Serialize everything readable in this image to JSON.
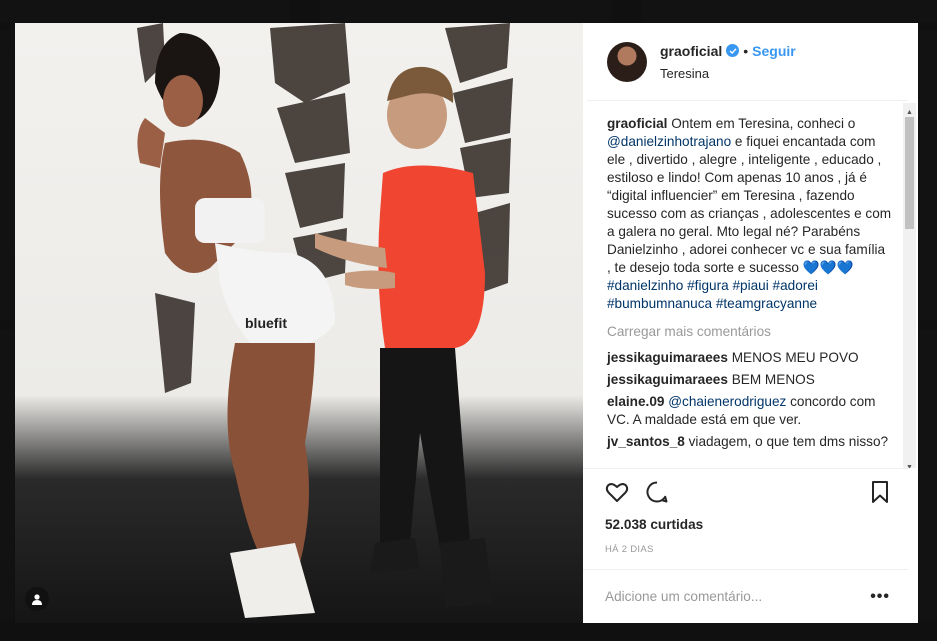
{
  "post": {
    "username": "graoficial",
    "follow_label": "Seguir",
    "location": "Teresina",
    "caption_user": "graoficial",
    "caption_parts": [
      {
        "t": "text",
        "v": " Ontem em Teresina, conheci o "
      },
      {
        "t": "link",
        "v": "@danielzinhotrajano"
      },
      {
        "t": "text",
        "v": " e fiquei encantada com ele , divertido , alegre , inteligente , educado , estiloso e lindo! Com apenas 10 anos , já é “digital influencier” em Teresina , fazendo sucesso com as crianças , adolescentes e com a galera no geral. Mto legal né? Parabéns Danielzinho , adorei conhecer vc e sua família , te desejo toda sorte e sucesso 💙💙💙 "
      },
      {
        "t": "link",
        "v": "#danielzinho"
      },
      {
        "t": "text",
        "v": " "
      },
      {
        "t": "link",
        "v": "#figura"
      },
      {
        "t": "text",
        "v": " "
      },
      {
        "t": "link",
        "v": "#piaui"
      },
      {
        "t": "text",
        "v": " "
      },
      {
        "t": "link",
        "v": "#adorei"
      },
      {
        "t": "text",
        "v": " "
      },
      {
        "t": "link",
        "v": "#bumbumnanuca"
      },
      {
        "t": "text",
        "v": " "
      },
      {
        "t": "link",
        "v": "#teamgracyanne"
      }
    ],
    "load_more": "Carregar mais comentários",
    "comments": [
      {
        "user": "jessikaguimaraees",
        "parts": [
          {
            "t": "text",
            "v": " MENOS MEU POVO"
          }
        ]
      },
      {
        "user": "jessikaguimaraees",
        "parts": [
          {
            "t": "text",
            "v": " BEM MENOS"
          }
        ]
      },
      {
        "user": "elaine.09",
        "parts": [
          {
            "t": "text",
            "v": " "
          },
          {
            "t": "link",
            "v": "@chaienerodriguez"
          },
          {
            "t": "text",
            "v": " concordo com VC. A maldade está em que ver."
          }
        ]
      },
      {
        "user": "jv_santos_8",
        "parts": [
          {
            "t": "text",
            "v": " viadagem, o que tem dms nisso?"
          }
        ]
      }
    ],
    "likes": "52.038 curtidas",
    "time_ago": "HÁ 2 DIAS",
    "comment_placeholder": "Adicione um comentário...",
    "more_options": "•••",
    "photo_text": "bluefit"
  },
  "icons": {
    "heart": "heart-icon",
    "comment": "comment-icon",
    "bookmark": "bookmark-icon",
    "verified": "verified-badge-icon",
    "user_tag": "user-tag-icon"
  },
  "colors": {
    "link": "#003569",
    "accent": "#3897f0",
    "muted": "#999999"
  }
}
